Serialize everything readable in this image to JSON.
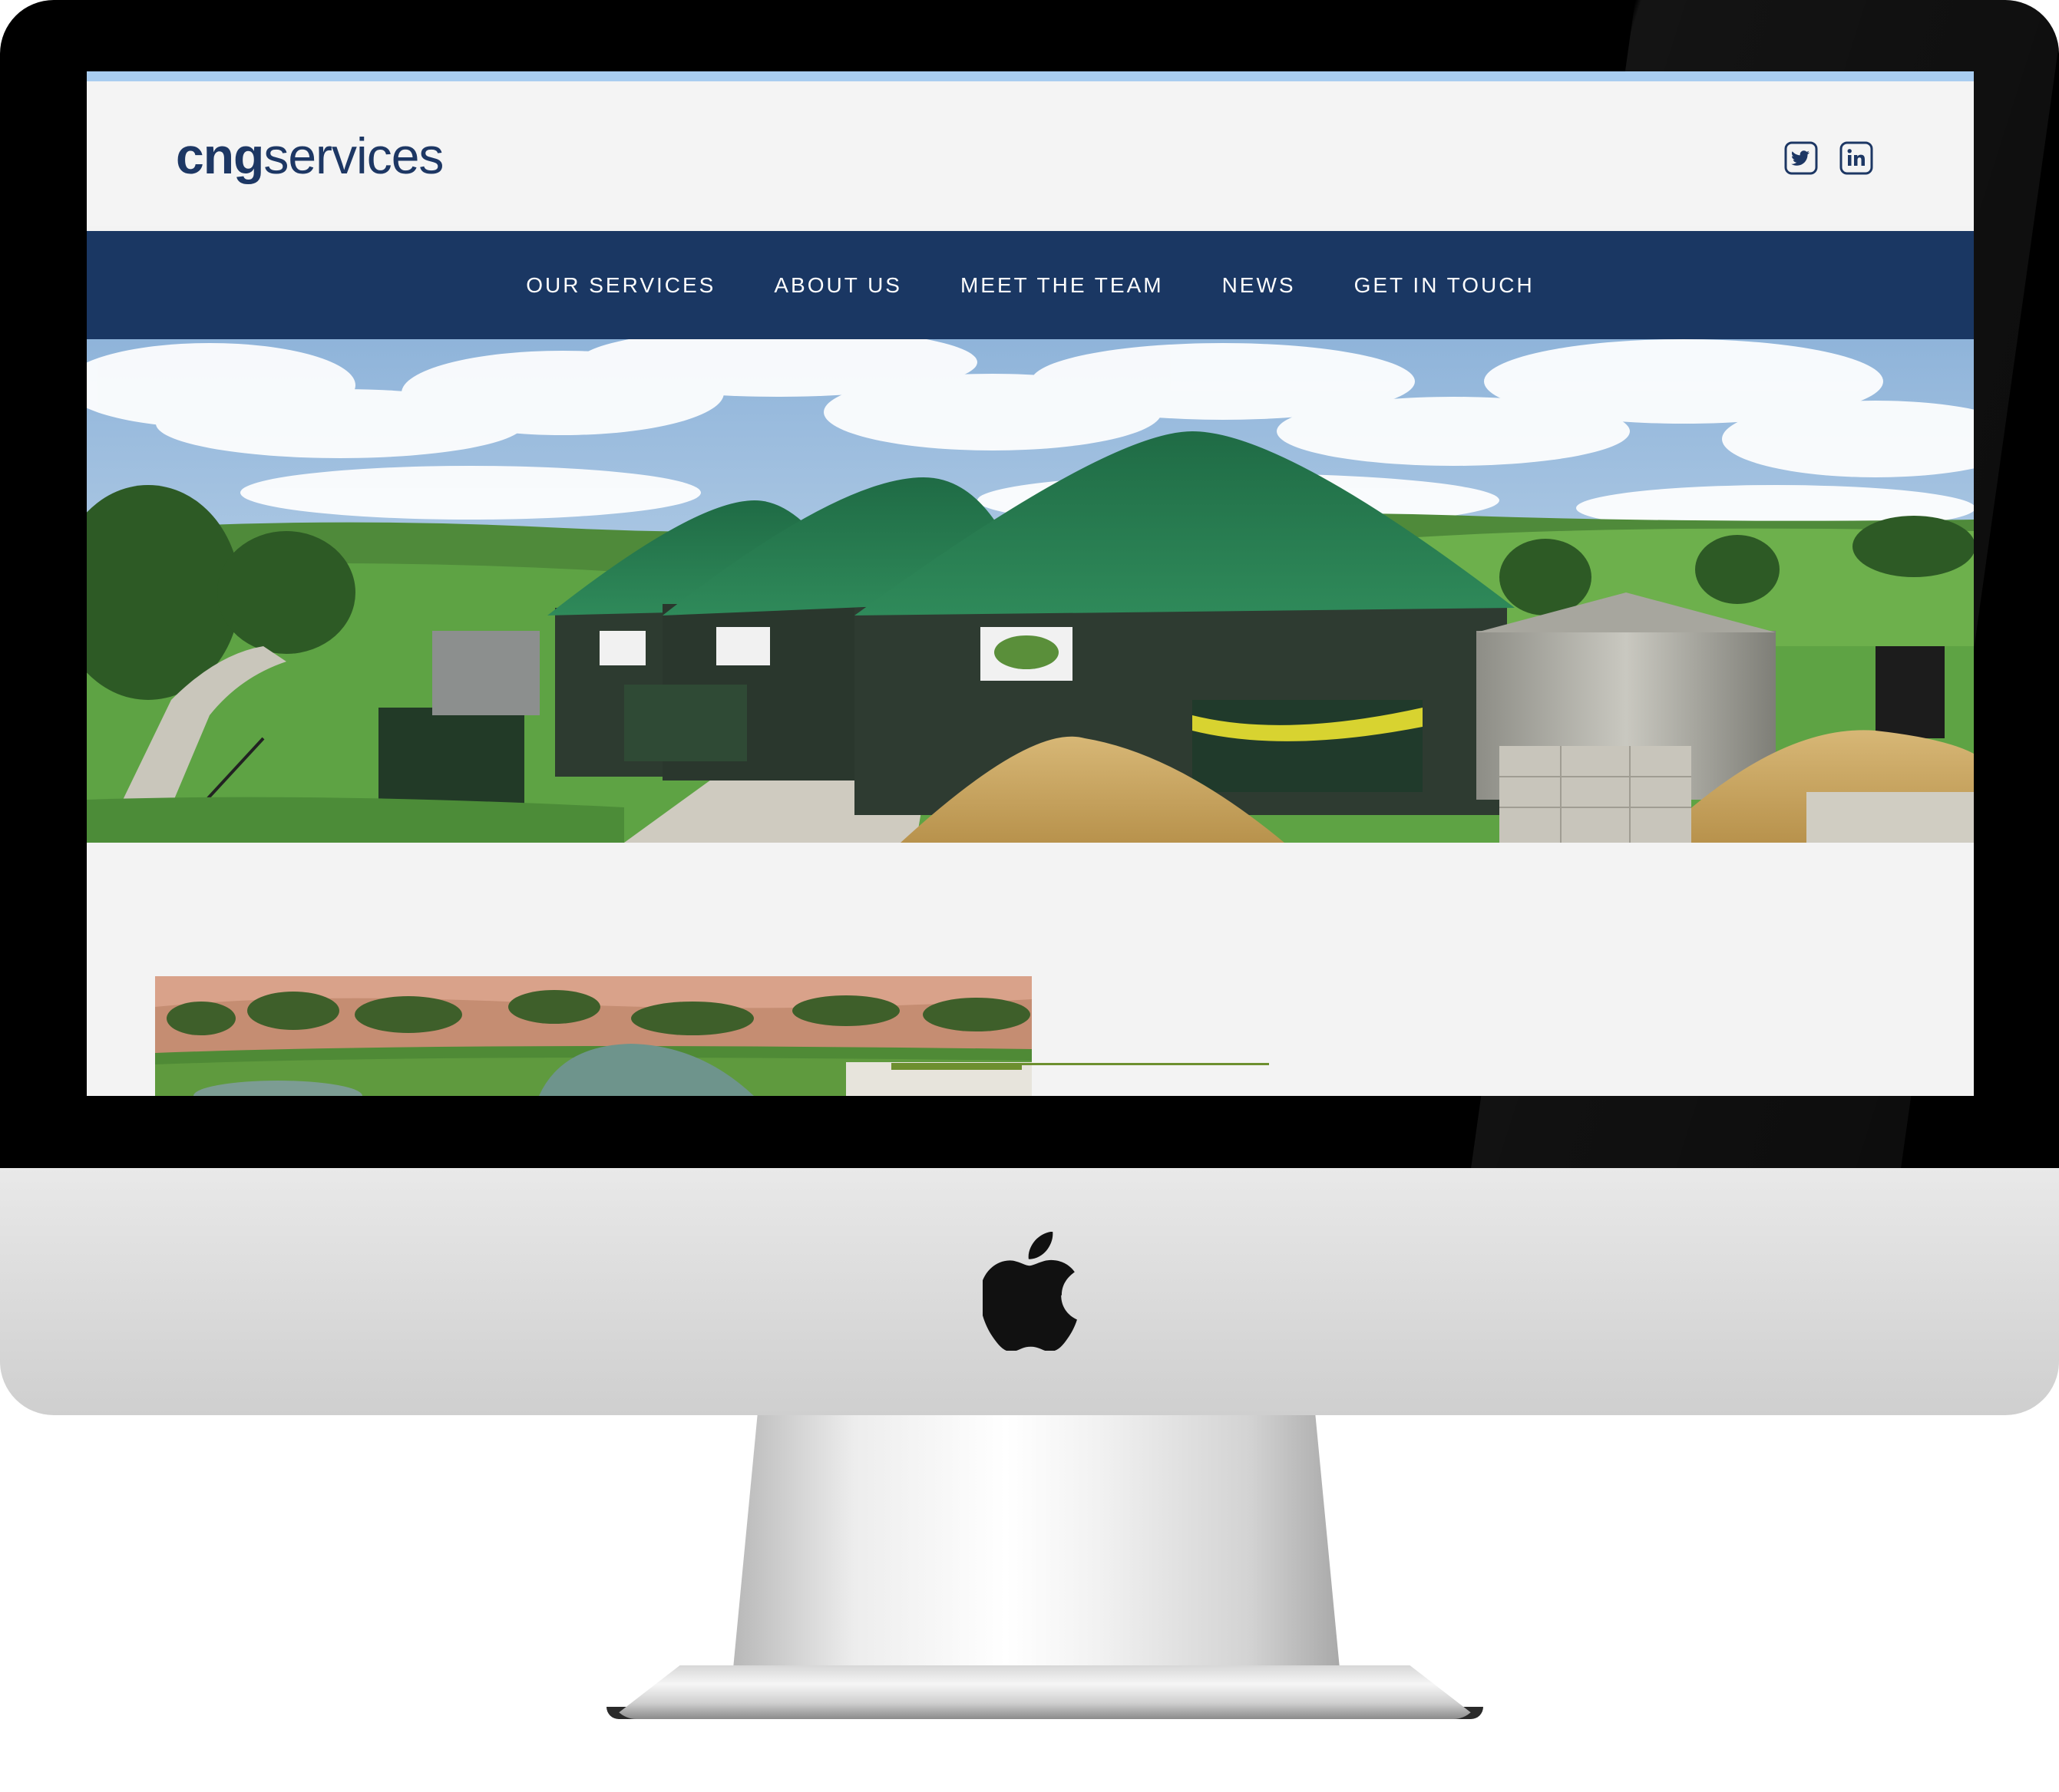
{
  "site": {
    "logo_bold": "cng",
    "logo_light": "services"
  },
  "social": [
    {
      "name": "twitter",
      "icon": "twitter-icon"
    },
    {
      "name": "linkedin",
      "icon": "linkedin-icon"
    }
  ],
  "nav": {
    "items": [
      {
        "label": "OUR SERVICES"
      },
      {
        "label": "ABOUT US"
      },
      {
        "label": "MEET THE TEAM"
      },
      {
        "label": "NEWS"
      },
      {
        "label": "GET IN TOUCH"
      }
    ]
  },
  "colors": {
    "brand_navy": "#1a3763",
    "top_accent": "#a9cdf0",
    "divider_green": "#6d8f2f",
    "page_background": "#f3f3f3"
  },
  "device": {
    "type": "iMac",
    "logo_icon": "apple-logo-icon"
  }
}
